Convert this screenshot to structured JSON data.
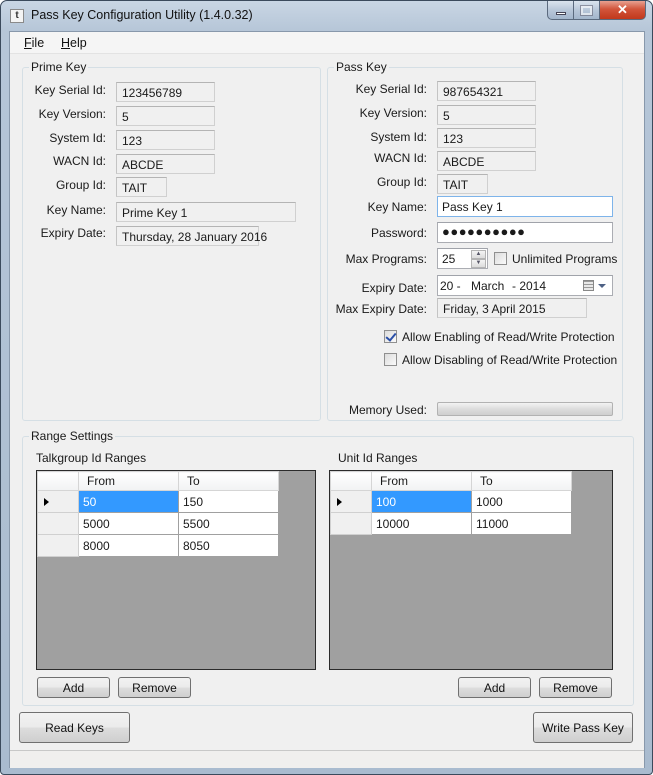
{
  "window": {
    "title": "Pass Key Configuration Utility (1.4.0.32)",
    "app_icon": "t",
    "controls": {
      "minimize": "minimize-icon",
      "maximize": "maximize-icon",
      "close": "close-icon"
    },
    "close_glyph": "✕"
  },
  "menu": [
    {
      "label": "File",
      "mnemonic": "F",
      "rest": "ile"
    },
    {
      "label": "Help",
      "mnemonic": "H",
      "rest": "elp"
    }
  ],
  "prime_key": {
    "title": "Prime Key",
    "fields": [
      {
        "label": "Key Serial Id:",
        "value": "123456789"
      },
      {
        "label": "Key Version:",
        "value": "5"
      },
      {
        "label": "System Id:",
        "value": "123"
      },
      {
        "label": "WACN Id:",
        "value": "ABCDE"
      },
      {
        "label": "Group Id:",
        "value": "TAIT"
      },
      {
        "label": "Key Name:",
        "value": "Prime Key 1"
      },
      {
        "label": "Expiry Date:",
        "value": "Thursday, 28 January 2016"
      }
    ]
  },
  "pass_key": {
    "title": "Pass Key",
    "fields": [
      {
        "label": "Key Serial Id:",
        "value": "987654321"
      },
      {
        "label": "Key Version:",
        "value": "5"
      },
      {
        "label": "System Id:",
        "value": "123"
      },
      {
        "label": "WACN Id:",
        "value": "ABCDE"
      },
      {
        "label": "Group Id:",
        "value": "TAIT"
      }
    ],
    "key_name": {
      "label": "Key Name:",
      "value": "Pass Key 1"
    },
    "password": {
      "label": "Password:",
      "value": "●●●●●●●●●●"
    },
    "max_programs": {
      "label": "Max Programs:",
      "value": "25",
      "spin_up": "▲",
      "spin_down": "▼"
    },
    "unlimited_programs": {
      "label": "Unlimited Programs",
      "checked": false
    },
    "expiry_date": {
      "label": "Expiry Date:",
      "day": "20 -",
      "month": "March",
      "year": "- 2014"
    },
    "max_expiry_date": {
      "label": "Max Expiry Date:",
      "value": "Friday, 3 April 2015"
    },
    "allow_enabling": {
      "label": "Allow Enabling of Read/Write Protection",
      "checked": true
    },
    "allow_disabling": {
      "label": "Allow Disabling of Read/Write Protection",
      "checked": false
    },
    "memory_used": {
      "label": "Memory Used:",
      "percent": 0
    }
  },
  "range_settings": {
    "title": "Range Settings",
    "talkgroup": {
      "title": "Talkgroup Id Ranges",
      "columns": [
        "From",
        "To"
      ],
      "rows": [
        {
          "from": "50",
          "to": "150"
        },
        {
          "from": "5000",
          "to": "5500"
        },
        {
          "from": "8000",
          "to": "8050"
        }
      ],
      "selected_row": 0,
      "add_label": "Add",
      "remove_label": "Remove"
    },
    "unit": {
      "title": "Unit Id Ranges",
      "columns": [
        "From",
        "To"
      ],
      "rows": [
        {
          "from": "100",
          "to": "1000"
        },
        {
          "from": "10000",
          "to": "11000"
        }
      ],
      "selected_row": 0,
      "add_label": "Add",
      "remove_label": "Remove"
    }
  },
  "actions": {
    "read_keys": "Read Keys",
    "write_pass_key": "Write Pass Key"
  },
  "colors": {
    "selection": "#3399ff",
    "grid_background": "#a0a0a0",
    "close_button": "#c9452a",
    "focus_border": "#7eb4ea"
  }
}
